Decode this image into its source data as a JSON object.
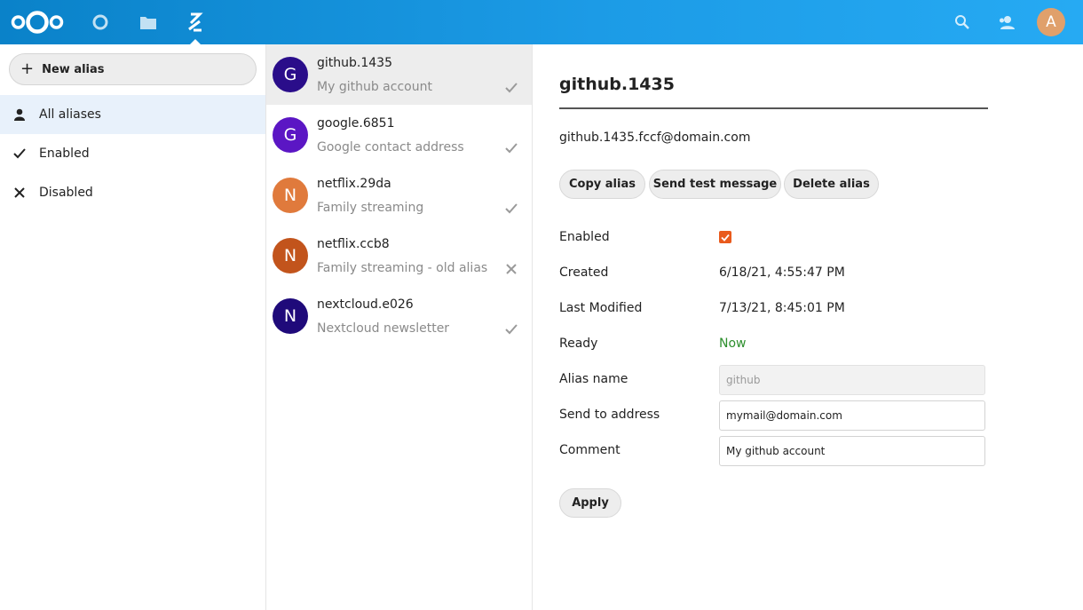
{
  "colors": {
    "header_start": "#0a82c9",
    "header_end": "#26aaf3",
    "accent": "#e95a1c",
    "ready_green": "#2d8f2d",
    "active_nav_bg": "#e8f1fb"
  },
  "header": {
    "logo_icon": "nextcloud-logo-icon",
    "apps": [
      "dashboard-icon",
      "files-icon",
      "aliases-app-icon"
    ],
    "active_app": "aliases-app-icon",
    "right_icons": [
      "search-icon",
      "contacts-icon"
    ],
    "user_avatar_letter": "A"
  },
  "sidebar": {
    "new_alias_label": "New alias",
    "items": [
      {
        "label": "All aliases",
        "icon": "user-icon",
        "active": true
      },
      {
        "label": "Enabled",
        "icon": "check-icon",
        "active": false
      },
      {
        "label": "Disabled",
        "icon": "close-icon",
        "active": false
      }
    ]
  },
  "aliases": [
    {
      "letter": "G",
      "name": "github.1435",
      "comment": "My github account",
      "status": "enabled",
      "color": "#2a0d8a",
      "active": true
    },
    {
      "letter": "G",
      "name": "google.6851",
      "comment": "Google contact address",
      "status": "enabled",
      "color": "#5b16c4",
      "active": false
    },
    {
      "letter": "N",
      "name": "netflix.29da",
      "comment": "Family streaming",
      "status": "enabled",
      "color": "#e07a3c",
      "active": false
    },
    {
      "letter": "N",
      "name": "netflix.ccb8",
      "comment": "Family streaming - old alias",
      "status": "disabled",
      "color": "#c2541c",
      "active": false
    },
    {
      "letter": "N",
      "name": "nextcloud.e026",
      "comment": "Nextcloud newsletter",
      "status": "enabled",
      "color": "#1f0a7a",
      "active": false
    }
  ],
  "detail": {
    "title": "github.1435",
    "email": "github.1435.fccf@domain.com",
    "buttons": {
      "copy": "Copy alias",
      "test": "Send test message",
      "delete": "Delete alias"
    },
    "fields": {
      "enabled_label": "Enabled",
      "enabled_value": true,
      "created_label": "Created",
      "created_value": "6/18/21, 4:55:47 PM",
      "modified_label": "Last Modified",
      "modified_value": "7/13/21, 8:45:01 PM",
      "ready_label": "Ready",
      "ready_value": "Now",
      "alias_name_label": "Alias name",
      "alias_name_value": "github",
      "send_to_label": "Send to address",
      "send_to_value": "mymail@domain.com",
      "comment_label": "Comment",
      "comment_value": "My github account"
    },
    "apply_label": "Apply"
  }
}
